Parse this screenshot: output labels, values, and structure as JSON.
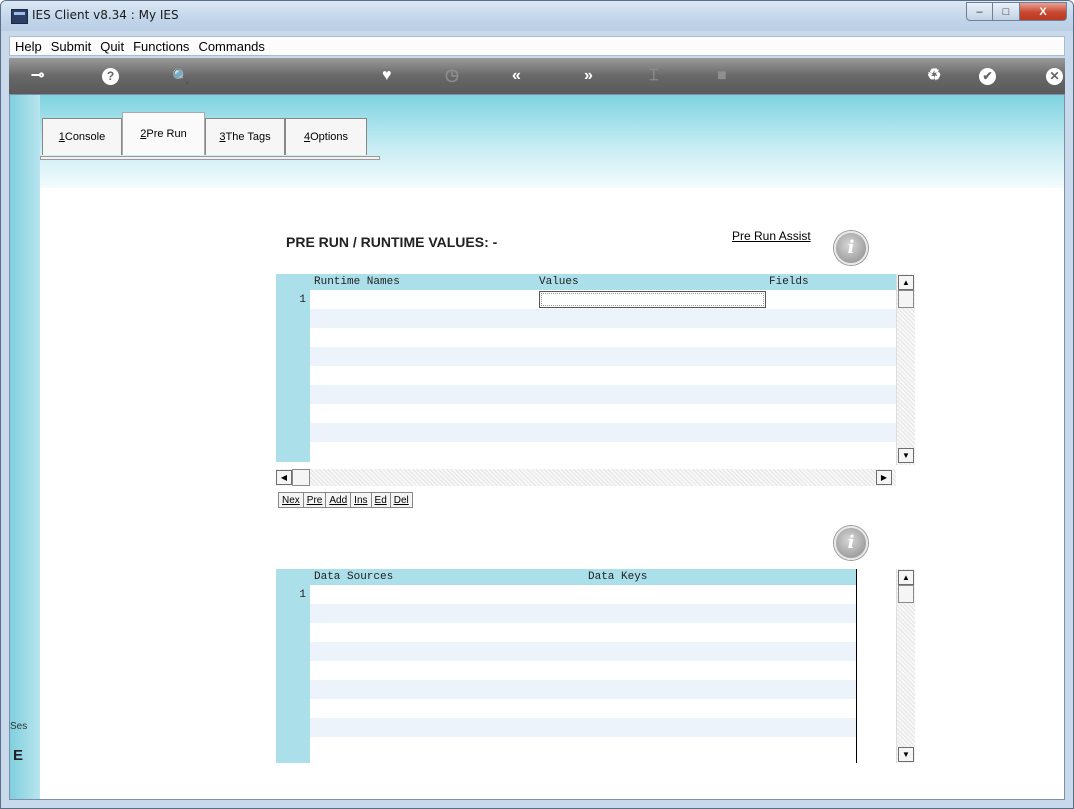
{
  "window": {
    "title": "IES Client v8.34 : My IES",
    "controls": {
      "minimize": "–",
      "maximize": "□",
      "close": "X"
    }
  },
  "menu": [
    "Help",
    "Submit",
    "Quit",
    "Functions",
    "Commands"
  ],
  "toolbar": {
    "icons": [
      "key-icon",
      "help-icon",
      "search-icon",
      "heart-icon",
      "clock-icon",
      "rewind-icon",
      "forward-icon",
      "tree-icon",
      "stop-icon",
      "recycle-icon",
      "check-icon",
      "cancel-icon"
    ],
    "glyphs": {
      "key": "⊸",
      "help": "?",
      "search": "🔍",
      "heart": "♥",
      "clock": "◷",
      "rewind": "«",
      "forward": "»",
      "tree": "⌶",
      "stop": "■",
      "recycle": "♻",
      "check": "✔",
      "cancel": "✕"
    }
  },
  "tabs": [
    {
      "key": "1",
      "label": " Console"
    },
    {
      "key": "2",
      "label": " Pre Run"
    },
    {
      "key": "3",
      "label": " The Tags"
    },
    {
      "key": "4",
      "label": " Options"
    }
  ],
  "active_tab": "2 Pre Run",
  "left_panel": {
    "session_label": "Ses",
    "session_glyph": "E"
  },
  "prerun": {
    "heading": "PRE RUN / RUNTIME VALUES: -",
    "assist_link": "Pre Run Assist",
    "info_glyph": "i",
    "grid": {
      "columns": [
        "Runtime Names",
        "Values",
        "Fields"
      ],
      "rows": [
        {
          "num": "1",
          "name": "",
          "value": "",
          "field": ""
        }
      ]
    },
    "buttons": [
      {
        "key": "N",
        "rest": "ex"
      },
      {
        "key": "P",
        "rest": "re"
      },
      {
        "key": "A",
        "rest": "dd"
      },
      {
        "key": "I",
        "rest": "ns"
      },
      {
        "key": "E",
        "rest": "d"
      },
      {
        "key": "D",
        "rest": "el"
      }
    ]
  },
  "data_sources": {
    "info_glyph": "i",
    "grid": {
      "columns": [
        "Data Sources",
        "Data Keys"
      ],
      "rows": [
        {
          "num": "1",
          "source": "",
          "key": ""
        }
      ]
    }
  },
  "scroll_glyphs": {
    "up": "▲",
    "down": "▼",
    "left": "◀",
    "right": "▶"
  }
}
